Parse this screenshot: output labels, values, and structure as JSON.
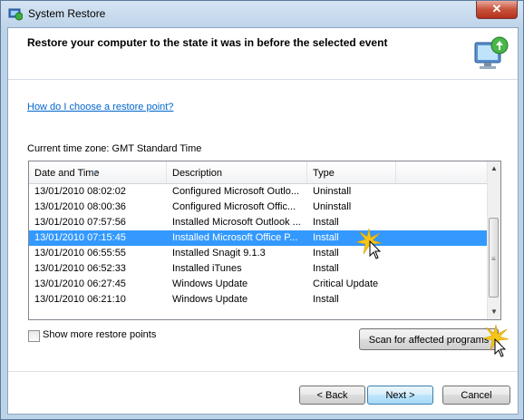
{
  "window": {
    "title": "System Restore",
    "close_label": "✕"
  },
  "header": {
    "heading": "Restore your computer to the state it was in before the selected event"
  },
  "help_link": "How do I choose a restore point?",
  "timezone_label": "Current time zone: GMT Standard Time",
  "table": {
    "columns": [
      "Date and Time",
      "Description",
      "Type"
    ],
    "rows": [
      {
        "date": "13/01/2010 08:02:02",
        "description": "Configured Microsoft Outlo...",
        "type": "Uninstall"
      },
      {
        "date": "13/01/2010 08:00:36",
        "description": "Configured Microsoft Offic...",
        "type": "Uninstall"
      },
      {
        "date": "13/01/2010 07:57:56",
        "description": "Installed Microsoft Outlook ...",
        "type": "Install"
      },
      {
        "date": "13/01/2010 07:15:45",
        "description": "Installed Microsoft Office P...",
        "type": "Install"
      },
      {
        "date": "13/01/2010 06:55:55",
        "description": "Installed Snagit 9.1.3",
        "type": "Install"
      },
      {
        "date": "13/01/2010 06:52:33",
        "description": "Installed iTunes",
        "type": "Install"
      },
      {
        "date": "13/01/2010 06:27:45",
        "description": "Windows Update",
        "type": "Critical Update"
      },
      {
        "date": "13/01/2010 06:21:10",
        "description": "Windows Update",
        "type": "Install"
      }
    ],
    "selected_row": 3
  },
  "show_more_label": "Show more restore points",
  "buttons": {
    "scan": "Scan for affected programs",
    "back": "< Back",
    "next": "Next >",
    "cancel": "Cancel"
  },
  "colors": {
    "selection": "#3399ff",
    "link": "#0066cc",
    "sparkle": "#f5c518"
  }
}
